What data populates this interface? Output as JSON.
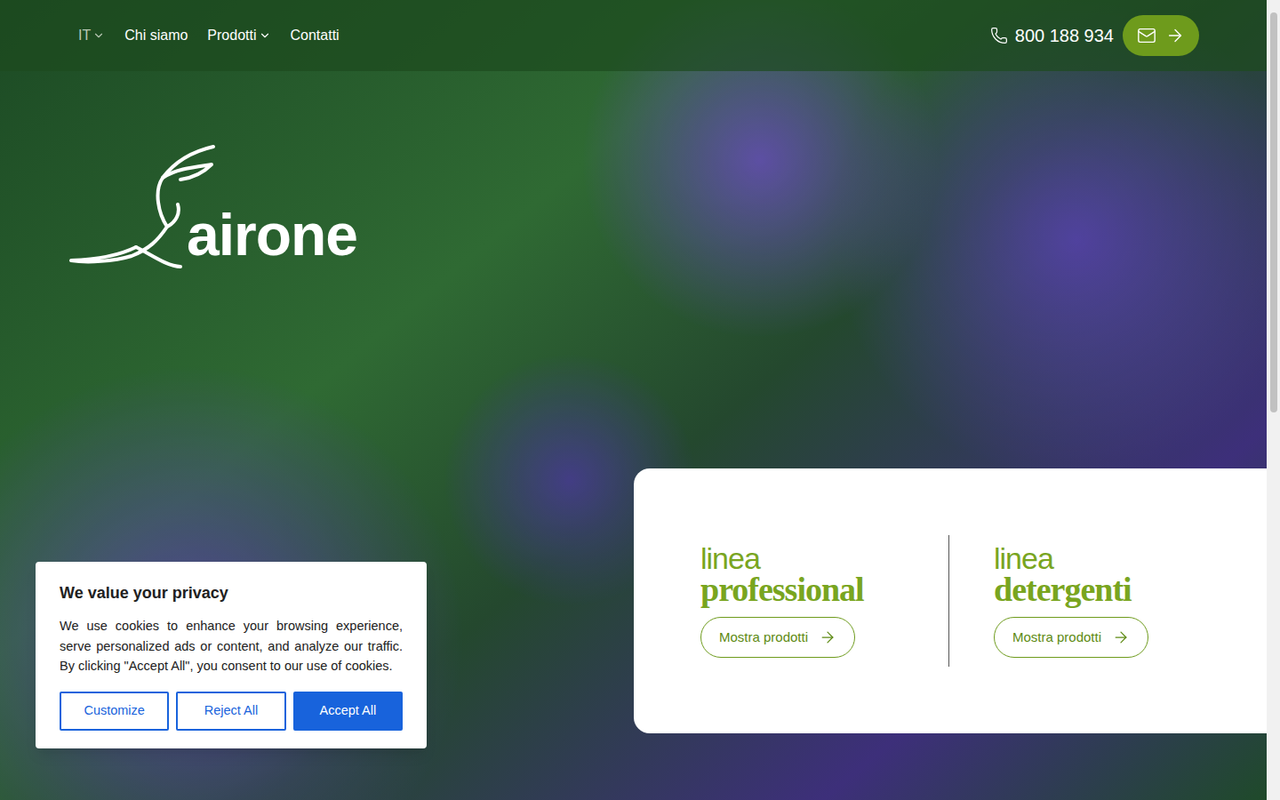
{
  "header": {
    "language": {
      "label": "IT",
      "has_menu": true,
      "expanded": false
    },
    "nav": [
      {
        "label": "Chi siamo",
        "has_menu": false
      },
      {
        "label": "Prodotti",
        "has_menu": true
      },
      {
        "label": "Contatti",
        "has_menu": false
      }
    ],
    "phone": "800 188 934"
  },
  "logo": {
    "text": "airone"
  },
  "product_lines": [
    {
      "prefix": "linea",
      "name": "professional",
      "button": "Mostra prodotti"
    },
    {
      "prefix": "linea",
      "name": "detergenti",
      "button": "Mostra prodotti"
    }
  ],
  "cookie_banner": {
    "title": "We value your privacy",
    "text": "We use cookies to enhance your browsing experience, serve personalized ads or content, and analyze our traffic. By clicking \"Accept All\", you consent to our use of cookies.",
    "buttons": [
      {
        "label": "Customize",
        "kind": "outline"
      },
      {
        "label": "Reject All",
        "kind": "outline"
      },
      {
        "label": "Accept All",
        "kind": "primary"
      }
    ]
  }
}
